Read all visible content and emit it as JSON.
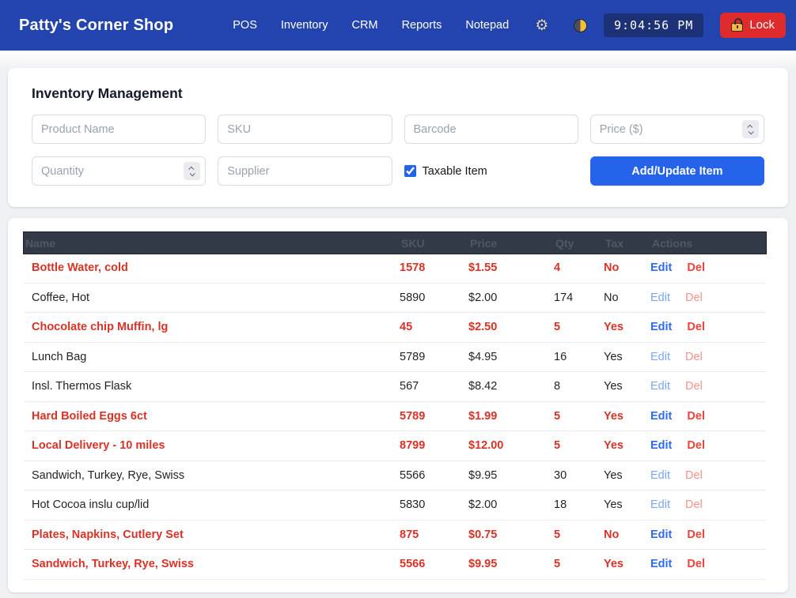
{
  "navbar": {
    "brand": "Patty's Corner Shop",
    "items": [
      {
        "label": "POS"
      },
      {
        "label": "Inventory"
      },
      {
        "label": "CRM"
      },
      {
        "label": "Reports"
      },
      {
        "label": "Notepad"
      }
    ],
    "icons": {
      "gear": "gear-icon",
      "theme_toggle": "moon-theme-toggle-icon",
      "lock": "padlock-icon"
    },
    "clock": "9:04:56 PM",
    "lock_label": "Lock"
  },
  "form": {
    "title": "Inventory Management",
    "fields": {
      "product_name_placeholder": "Product Name",
      "sku_placeholder": "SKU",
      "barcode_placeholder": "Barcode",
      "price_placeholder": "Price ($)",
      "quantity_placeholder": "Quantity",
      "supplier_placeholder": "Supplier"
    },
    "taxable_label": "Taxable Item",
    "taxable_checked": true,
    "submit_label": "Add/Update Item"
  },
  "table": {
    "headers": [
      "Name",
      "SKU",
      "Price",
      "Qty",
      "Tax",
      "Actions"
    ],
    "edit_label": "Edit",
    "del_label": "Del",
    "rows": [
      {
        "name": "Bottle Water, cold",
        "sku": "1578",
        "price": "$1.55",
        "qty": "4",
        "tax": "No",
        "low_stock": true
      },
      {
        "name": "Coffee, Hot",
        "sku": "5890",
        "price": "$2.00",
        "qty": "174",
        "tax": "No",
        "low_stock": false
      },
      {
        "name": "Chocolate chip Muffin, lg",
        "sku": "45",
        "price": "$2.50",
        "qty": "5",
        "tax": "Yes",
        "low_stock": true
      },
      {
        "name": "Lunch Bag",
        "sku": "5789",
        "price": "$4.95",
        "qty": "16",
        "tax": "Yes",
        "low_stock": false
      },
      {
        "name": "Insl. Thermos Flask",
        "sku": "567",
        "price": "$8.42",
        "qty": "8",
        "tax": "Yes",
        "low_stock": false
      },
      {
        "name": "Hard Boiled Eggs 6ct",
        "sku": "5789",
        "price": "$1.99",
        "qty": "5",
        "tax": "Yes",
        "low_stock": true
      },
      {
        "name": "Local Delivery - 10 miles",
        "sku": "8799",
        "price": "$12.00",
        "qty": "5",
        "tax": "Yes",
        "low_stock": true
      },
      {
        "name": "Sandwich, Turkey, Rye, Swiss",
        "sku": "5566",
        "price": "$9.95",
        "qty": "30",
        "tax": "Yes",
        "low_stock": false
      },
      {
        "name": "Hot Cocoa inslu cup/lid",
        "sku": "5830",
        "price": "$2.00",
        "qty": "18",
        "tax": "Yes",
        "low_stock": false
      },
      {
        "name": "Plates, Napkins, Cutlery Set",
        "sku": "875",
        "price": "$0.75",
        "qty": "5",
        "tax": "No",
        "low_stock": true
      },
      {
        "name": "Sandwich, Turkey, Rye, Swiss",
        "sku": "5566",
        "price": "$9.95",
        "qty": "5",
        "tax": "Yes",
        "low_stock": true
      }
    ]
  },
  "colors": {
    "navbar_bg": "#2344af",
    "accent_blue": "#2563eb",
    "lock_red": "#df2b2b",
    "low_stock_red": "#d93226",
    "table_header_bg": "#333a47",
    "clock_bg": "#1d3176"
  }
}
